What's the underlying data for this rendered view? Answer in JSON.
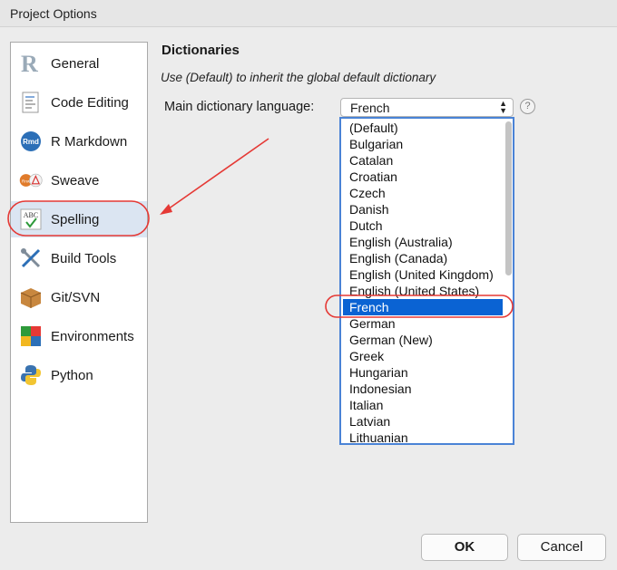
{
  "window": {
    "title": "Project Options"
  },
  "sidebar": {
    "items": [
      {
        "label": "General",
        "icon": "r-logo-icon"
      },
      {
        "label": "Code Editing",
        "icon": "code-document-icon"
      },
      {
        "label": "R Markdown",
        "icon": "rmd-icon"
      },
      {
        "label": "Sweave",
        "icon": "sweave-pdf-icon"
      },
      {
        "label": "Spelling",
        "icon": "abc-check-icon",
        "selected": true
      },
      {
        "label": "Build Tools",
        "icon": "wrench-screwdriver-icon"
      },
      {
        "label": "Git/SVN",
        "icon": "git-box-icon"
      },
      {
        "label": "Environments",
        "icon": "colored-blocks-icon"
      },
      {
        "label": "Python",
        "icon": "python-icon"
      }
    ]
  },
  "content": {
    "title": "Dictionaries",
    "hint": "Use (Default) to inherit the global default dictionary",
    "language_label": "Main dictionary language:",
    "language_value": "French",
    "help_glyph": "?"
  },
  "dropdown": {
    "options": [
      "(Default)",
      "Bulgarian",
      "Catalan",
      "Croatian",
      "Czech",
      "Danish",
      "Dutch",
      "English (Australia)",
      "English (Canada)",
      "English (United Kingdom)",
      "English (United States)",
      "French",
      "German",
      "German (New)",
      "Greek",
      "Hungarian",
      "Indonesian",
      "Italian",
      "Latvian",
      "Lithuanian"
    ],
    "selected": "French"
  },
  "buttons": {
    "ok": "OK",
    "cancel": "Cancel"
  },
  "colors": {
    "selection": "#0a63d3",
    "annotation": "#e53935",
    "sidebar_selected": "#dbe5f2"
  }
}
